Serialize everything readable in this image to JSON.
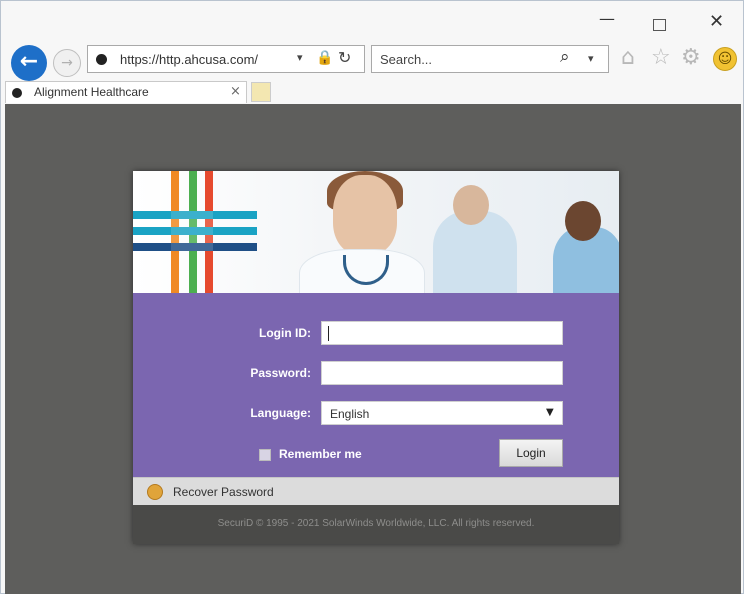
{
  "window": {
    "minimize_glyph": "—",
    "close_glyph": "✕"
  },
  "nav": {
    "back_glyph": "←",
    "forward_glyph": "→",
    "url": "https://http.ahcusa.com/",
    "addr_dropdown_glyph": "▾",
    "lock_glyph": "🔒",
    "refresh_glyph": "↻",
    "search_placeholder": "Search...",
    "search_glyph": "⌕",
    "search_dropdown_glyph": "▾",
    "home_glyph": "⌂",
    "favorites_glyph": "☆",
    "settings_glyph": "⚙",
    "feedback_glyph": "☺"
  },
  "tab": {
    "title": "Alignment Healthcare",
    "close_glyph": "×"
  },
  "login": {
    "login_id_label": "Login ID:",
    "login_id_value": "",
    "password_label": "Password:",
    "password_value": "",
    "language_label": "Language:",
    "language_value": "English",
    "language_arrow": "▼",
    "remember_label": "Remember me",
    "remember_checked": false,
    "login_button": "Login",
    "recover_label": "Recover Password",
    "copyright": "SecuriD © 1995 - 2021 SolarWinds Worldwide, LLC. All rights reserved."
  },
  "colors": {
    "form_bg": "#7b66b0",
    "page_bg": "#5e5e5c",
    "back_button": "#1e6fc8",
    "logo_orange": "#f08a24",
    "logo_green": "#4caf50",
    "logo_red": "#e64a2e",
    "logo_teal": "#1aa3c4",
    "logo_navy": "#1f4f86"
  }
}
